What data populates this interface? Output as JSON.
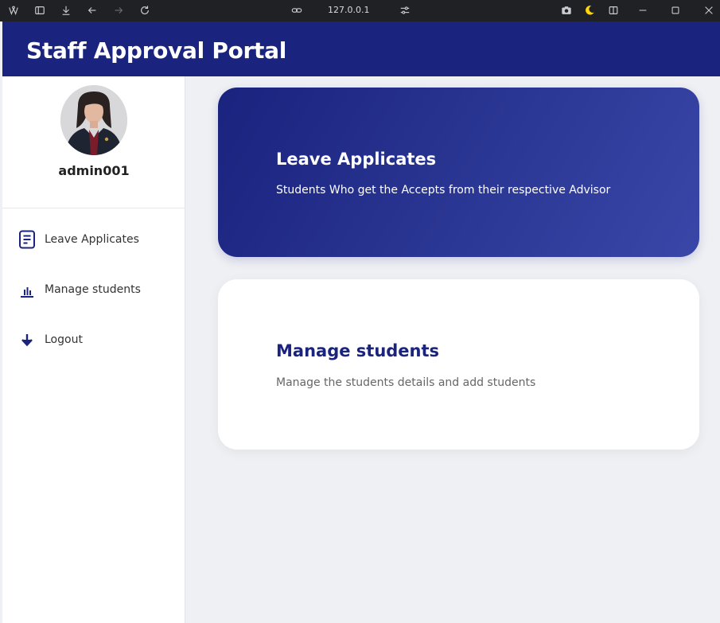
{
  "browser": {
    "url": "127.0.0.1",
    "icons": [
      "app-logo-icon",
      "sidebar-toggle-icon",
      "download-icon",
      "back-arrow-icon",
      "forward-arrow-icon",
      "reload-icon",
      "link-icon",
      "tune-icon",
      "camera-icon",
      "moon-icon",
      "split-view-icon",
      "minimize-icon",
      "maximize-icon",
      "close-icon"
    ]
  },
  "header": {
    "title": "Staff Approval Portal",
    "color": "#1a237e"
  },
  "sidebar": {
    "username": "admin001",
    "items": [
      {
        "label": "Leave Applicates",
        "icon": "document-icon"
      },
      {
        "label": "Manage students",
        "icon": "bar-chart-icon"
      },
      {
        "label": "Logout",
        "icon": "arrow-down-icon"
      }
    ]
  },
  "cards": [
    {
      "title": "Leave Applicates",
      "description": "Students Who get the Accepts from their respective Advisor"
    },
    {
      "title": "Manage students",
      "description": "Manage the students details and add students"
    }
  ]
}
